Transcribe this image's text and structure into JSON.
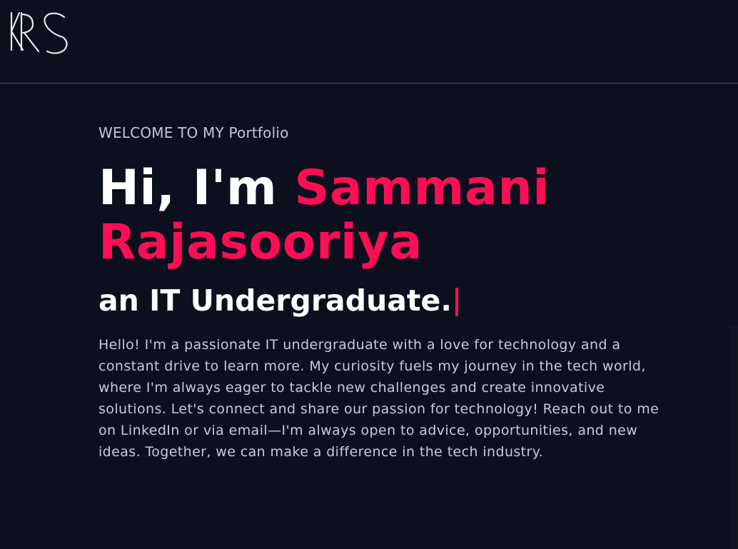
{
  "header": {
    "logo_alt": "KRS"
  },
  "hero": {
    "welcome": "WELCOME TO MY Portfolio",
    "greeting": "Hi, I'm ",
    "name": "Sammani Rajasooriya",
    "role": "an IT Undergraduate.",
    "bio": "Hello! I'm a passionate IT undergraduate with a love for technology and a constant drive to learn more. My curiosity fuels my journey in the tech world, where I'm always eager to tackle new challenges and create innovative solutions. Let's connect and share our passion for technology! Reach out to me on LinkedIn or via email—I'm always open to advice, opportunities, and new ideas. Together, we can make a difference in the tech industry."
  },
  "colors": {
    "background": "#0b0f1e",
    "accent": "#ff0d55",
    "text": "#ffffff",
    "muted_text": "#c9ccd6"
  }
}
